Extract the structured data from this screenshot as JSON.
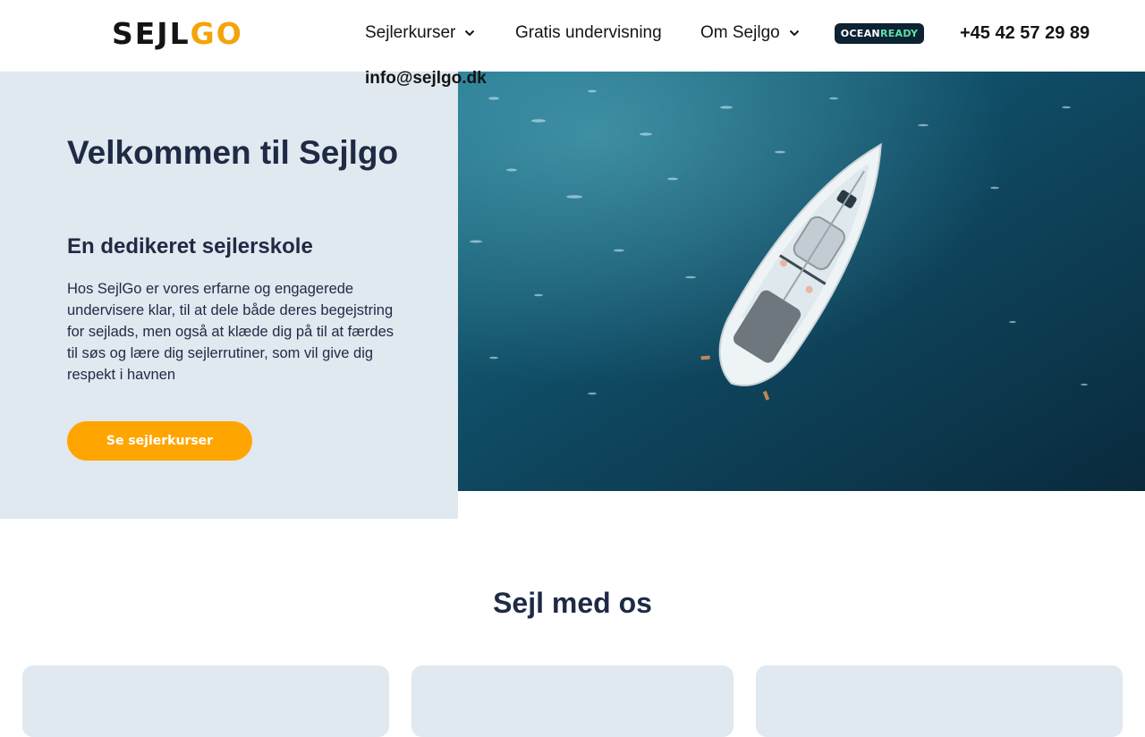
{
  "header": {
    "logo": {
      "part1": "SEJL",
      "part2": "GO"
    },
    "nav": [
      {
        "label": "Sejlerkurser",
        "dropdown": true
      },
      {
        "label": "Gratis undervisning",
        "dropdown": false
      },
      {
        "label": "Om Sejlgo",
        "dropdown": true
      }
    ],
    "badge": {
      "part1": "OCEAN",
      "part2": "READY"
    },
    "phone": "+45 42 57 29 89",
    "email": "info@sejlgo.dk"
  },
  "hero": {
    "title": "Velkommen til Sejlgo",
    "subtitle": "En dedikeret sejlerskole",
    "text": "Hos SejlGo er vores erfarne og engagerede undervisere klar, til at dele både deres begejstring for sejlads, men også at klæde dig på til at færdes til søs og lære dig sejlerrutiner, som vil give dig respekt i havnen",
    "button_label": "Se sejlerkurser"
  },
  "section": {
    "title": "Sejl med os"
  },
  "colors": {
    "brand_orange": "#ffa500",
    "navy_text": "#1f2a44",
    "light_panel": "#e0e8f0",
    "sea": "#0f4a63"
  },
  "icons": [
    "chevron-down-icon",
    "sailboat-image"
  ]
}
